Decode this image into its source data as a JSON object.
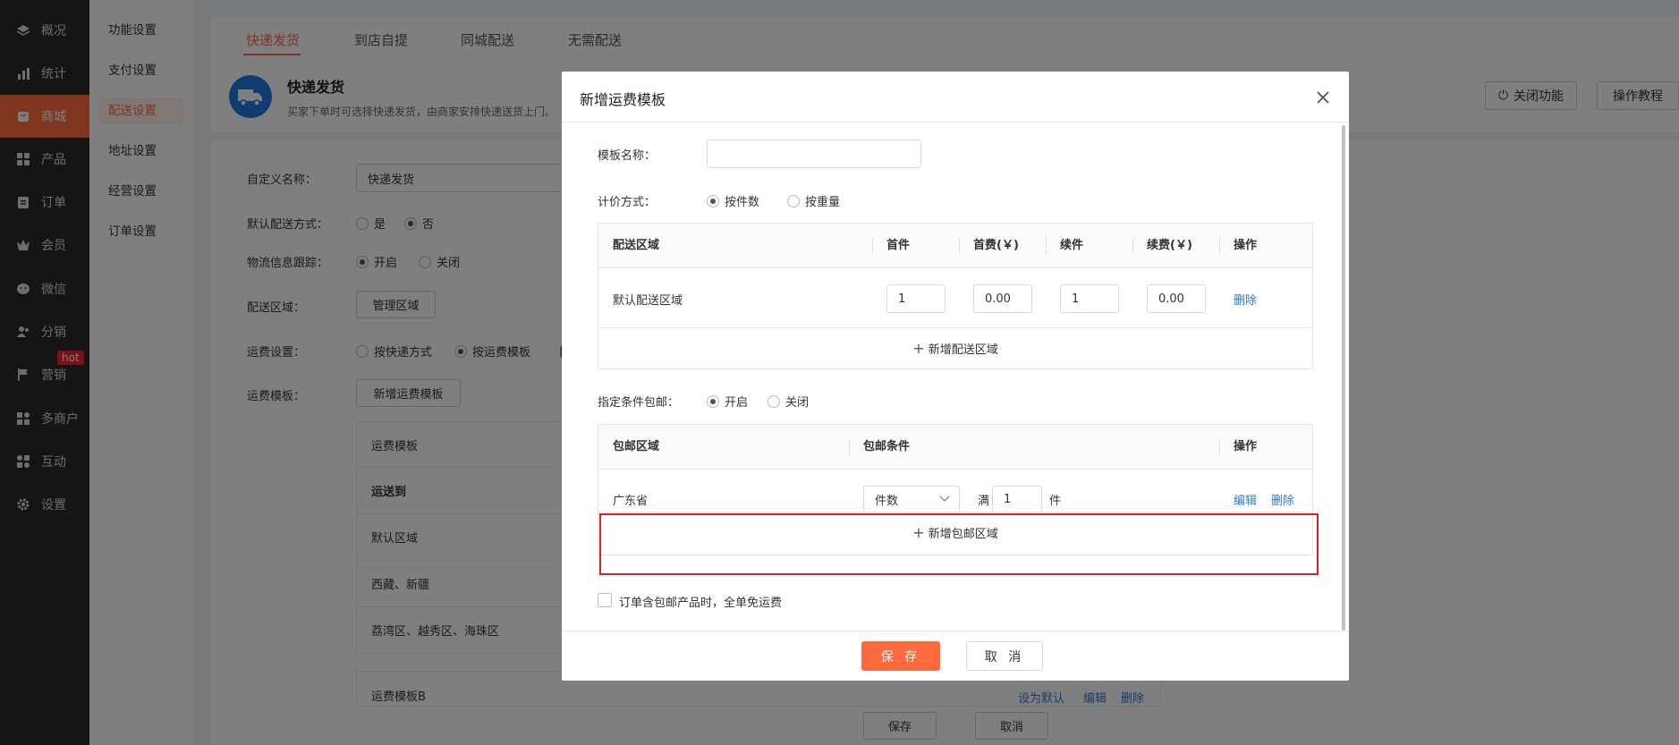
{
  "sidebar": {
    "items": [
      {
        "label": "概况",
        "icon": "layers-icon"
      },
      {
        "label": "统计",
        "icon": "chart-icon"
      },
      {
        "label": "商城",
        "icon": "shop-icon"
      },
      {
        "label": "产品",
        "icon": "grid-icon"
      },
      {
        "label": "订单",
        "icon": "clipboard-icon"
      },
      {
        "label": "会员",
        "icon": "crown-icon"
      },
      {
        "label": "微信",
        "icon": "wechat-icon"
      },
      {
        "label": "分销",
        "icon": "users-icon"
      },
      {
        "label": "营销",
        "icon": "flag-icon"
      },
      {
        "label": "多商户",
        "icon": "store-icon"
      },
      {
        "label": "互动",
        "icon": "apps-icon"
      },
      {
        "label": "设置",
        "icon": "gear-icon"
      }
    ],
    "active": "商城",
    "hot_badge": "hot",
    "accent": "#ff6a3d"
  },
  "submenu": {
    "items": [
      "功能设置",
      "支付设置",
      "配送设置",
      "地址设置",
      "经营设置",
      "订单设置"
    ],
    "active": "配送设置"
  },
  "tabs": [
    "快递发货",
    "到店自提",
    "同城配送",
    "无需配送"
  ],
  "header": {
    "title": "快递发货",
    "desc": "买家下单时可选择快递发货，由商家安排快递送货上门。",
    "close_label": "关闭功能",
    "tutorial_label": "操作教程"
  },
  "page": {
    "custom_name_label": "自定义名称：",
    "custom_name_value": "快递发货",
    "default_label": "默认配送方式：",
    "yes": "是",
    "no": "否",
    "tracking_label": "物流信息跟踪：",
    "on": "开启",
    "off": "关闭",
    "area_label": "配送区域：",
    "manage_area": "管理区域",
    "fee_label": "运费设置：",
    "fee_opt1": "按快递方式",
    "fee_opt2": "按运费模板",
    "fee_tail": "【",
    "tpl_label": "运费模板：",
    "add_tpl": "新增运费模板",
    "tpl_rows": [
      "运费模板",
      "运送到",
      "默认区域",
      "西藏、新疆",
      "荔湾区、越秀区、海珠区"
    ],
    "tpl_footer_name": "运费模板B",
    "tpl_footer_links": [
      "设为默认",
      "编辑",
      "删除"
    ],
    "save": "保存",
    "cancel": "取消"
  },
  "modal": {
    "title": "新增运费模板",
    "name_label": "模板名称：",
    "name_value": "",
    "pricing_label": "计价方式：",
    "pricing_opts": [
      "按件数",
      "按重量"
    ],
    "pricing_selected": "按件数",
    "fee_table": {
      "headers": [
        "配送区域",
        "首件",
        "首费(￥)",
        "续件",
        "续费(￥)",
        "操作"
      ],
      "rows": [
        {
          "area": "默认配送区域",
          "first": "1",
          "first_fee": "0.00",
          "next": "1",
          "next_fee": "0.00",
          "action": "删除"
        }
      ],
      "add_label": "新增配送区域"
    },
    "free_label": "指定条件包邮：",
    "free_opts": [
      "开启",
      "关闭"
    ],
    "free_selected": "开启",
    "free_table": {
      "headers": [
        "包邮区域",
        "包邮条件",
        "操作"
      ],
      "rows": [
        {
          "area": "广东省",
          "cond_type": "件数",
          "cond_prefix": "满",
          "cond_value": "1",
          "cond_unit": "件",
          "edit": "编辑",
          "delete": "删除"
        }
      ],
      "add_label": "新增包邮区域"
    },
    "checkbox_label": "订单含包邮产品时，全单免运费",
    "save": "保 存",
    "cancel": "取 消"
  }
}
